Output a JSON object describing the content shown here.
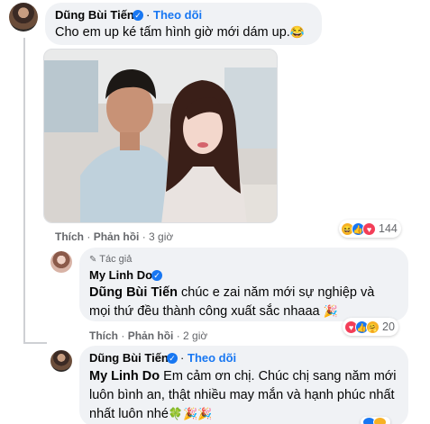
{
  "comment1": {
    "author": "Dũng Bùi Tiến",
    "follow_label": "Theo dõi",
    "text": "Cho em up ké tấm hình giờ mới dám up.",
    "emoji": "😂",
    "actions": {
      "like": "Thích",
      "reply": "Phản hồi",
      "time": "3 giờ"
    },
    "reactions": {
      "icons": [
        "haha-icon",
        "like-icon",
        "love-icon"
      ],
      "count": "144"
    }
  },
  "reply1": {
    "author_badge": "Tác giả",
    "author": "My Linh Do",
    "mention": "Dũng Bùi Tiến",
    "text": " chúc e zai năm mới sự nghiệp và mọi thứ đều thành công xuất sắc nhaaa",
    "emoji": "🎉",
    "actions": {
      "like": "Thích",
      "reply": "Phản hồi",
      "time": "2 giờ"
    },
    "reactions": {
      "icons": [
        "love-icon",
        "like-icon",
        "care-icon"
      ],
      "count": "20"
    }
  },
  "reply2": {
    "author": "Dũng Bùi Tiến",
    "follow_label": "Theo dõi",
    "mention": "My Linh Do",
    "text": " Em cảm ơn chị. Chúc chị sang năm mới luôn bình an, thật nhiều may mắn và hạnh phúc nhất nhất luôn nhé",
    "emoji": "🍀🎉🎉"
  },
  "colors": {
    "bubble": "#f0f2f5",
    "link_blue": "#1877f2",
    "meta_gray": "#65676b",
    "text": "#050505"
  }
}
